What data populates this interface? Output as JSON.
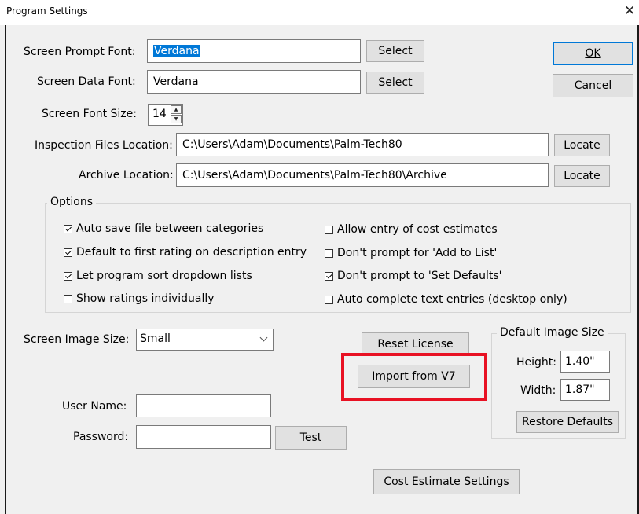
{
  "window": {
    "title": "Program Settings",
    "close_glyph": "✕"
  },
  "fonts": {
    "prompt_label": "Screen Prompt Font:",
    "prompt_value": "Verdana",
    "data_label": "Screen Data Font:",
    "data_value": "Verdana",
    "select_label": "Select",
    "size_label": "Screen Font Size:",
    "size_value": "14",
    "spin_up": "▲",
    "spin_down": "▼"
  },
  "locations": {
    "inspection_label": "Inspection Files Location:",
    "inspection_value": "C:\\Users\\Adam\\Documents\\Palm-Tech80",
    "archive_label": "Archive Location:",
    "archive_value": "C:\\Users\\Adam\\Documents\\Palm-Tech80\\Archive",
    "locate_label": "Locate"
  },
  "dialog_buttons": {
    "ok_label": "OK",
    "cancel_label": "Cancel"
  },
  "options": {
    "title": "Options",
    "items": [
      {
        "label": "Auto save file between categories",
        "checked": true
      },
      {
        "label": "Default to first rating on description entry",
        "checked": true
      },
      {
        "label": "Let program sort dropdown lists",
        "checked": true
      },
      {
        "label": "Show ratings individually",
        "checked": false
      },
      {
        "label": "Allow entry of cost estimates",
        "checked": false
      },
      {
        "label": "Don't prompt for 'Add to List'",
        "checked": false
      },
      {
        "label": "Don't prompt to 'Set Defaults'",
        "checked": true
      },
      {
        "label": "Auto complete text entries (desktop only)",
        "checked": false
      }
    ]
  },
  "image": {
    "size_label": "Screen Image Size:",
    "size_value": "Small"
  },
  "license": {
    "reset_label": "Reset License",
    "import_label": "Import from V7",
    "highlight_color": "#e81123"
  },
  "default_image": {
    "title": "Default Image Size",
    "height_label": "Height:",
    "height_value": "1.40\"",
    "width_label": "Width:",
    "width_value": "1.87\"",
    "restore_label": "Restore Defaults"
  },
  "account": {
    "username_label": "User Name:",
    "username_value": "",
    "password_label": "Password:",
    "password_value": "",
    "test_label": "Test"
  },
  "cost_button_label": "Cost Estimate Settings",
  "colors": {
    "selection": "#0078d7",
    "window_bg": "#f0f0f0",
    "button_bg": "#e1e1e1"
  }
}
